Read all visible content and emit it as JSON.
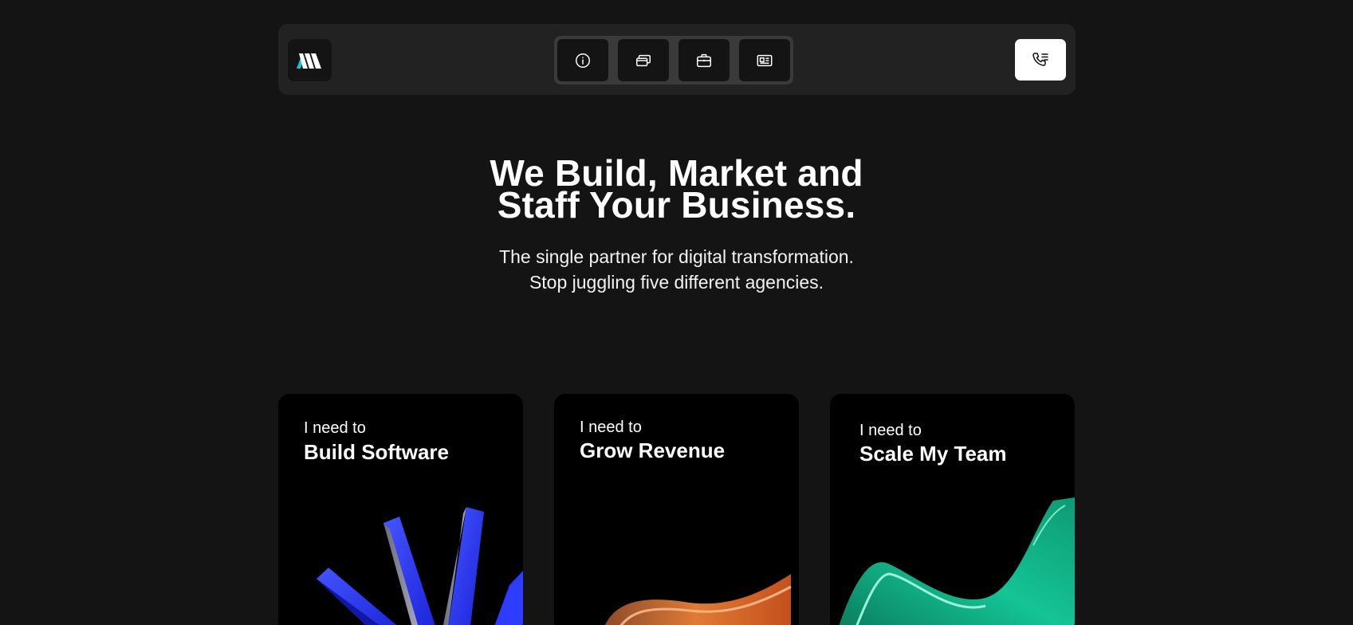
{
  "header": {
    "logo_name": "logo",
    "nav_icons": [
      "info-icon",
      "cards-icon",
      "briefcase-icon",
      "newspaper-icon"
    ],
    "call_icon": "phone-list-icon"
  },
  "hero": {
    "title_line1": "We Build, Market and",
    "title_line2": "Staff Your Business.",
    "subtitle_line1": "The single partner for digital transformation.",
    "subtitle_line2": "Stop juggling five different agencies."
  },
  "cards": [
    {
      "kicker": "I need to",
      "title": "Build Software",
      "accent": "#2b3bff"
    },
    {
      "kicker": "I need to",
      "title": "Grow Revenue",
      "accent": "#e0702a"
    },
    {
      "kicker": "I need to",
      "title": "Scale My Team",
      "accent": "#12b98a"
    }
  ],
  "colors": {
    "background": "#141414",
    "navbar": "#222222",
    "card": "#000000",
    "logo_accent": "#19c2d6"
  }
}
